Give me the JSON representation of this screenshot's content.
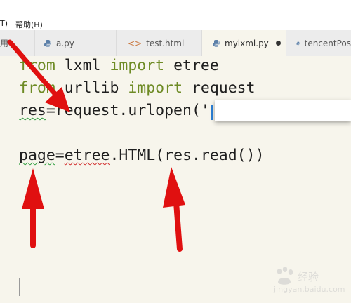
{
  "menu": {
    "item_partial": "T)",
    "help": "帮助(H)"
  },
  "tabs": [
    {
      "label": "用",
      "icon": "python-icon",
      "active": false
    },
    {
      "label": "a.py",
      "icon": "python-icon",
      "active": false
    },
    {
      "label": "test.html",
      "icon": "html-icon",
      "active": false
    },
    {
      "label": "mylxml.py",
      "icon": "python-icon",
      "active": true,
      "modified": true
    },
    {
      "label": "tencentPos",
      "icon": "python-icon",
      "active": false
    }
  ],
  "code": {
    "line1": {
      "kw1": "from",
      "mid": " lxml ",
      "kw2": "import",
      "rest": " etree"
    },
    "line2": {
      "kw1": "from",
      "mid": " urllib ",
      "kw2": "import",
      "rest": " request"
    },
    "line3": {
      "var": "res",
      "rest": "=request.urlopen('"
    },
    "line4": {
      "var": "page",
      "eq": "=",
      "call": "etree",
      "rest": ".HTML(res.read())"
    }
  },
  "watermark": {
    "line1": "经验",
    "line2": "jingyan.baidu.com"
  },
  "colors": {
    "keyword": "#6e8b25",
    "arrow": "#e01010",
    "background": "#f7f5ec"
  }
}
